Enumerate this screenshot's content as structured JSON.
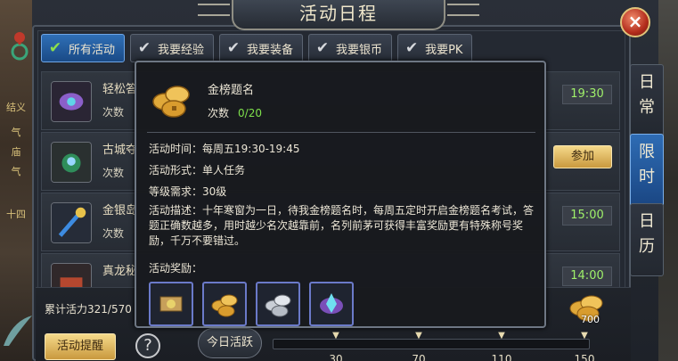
{
  "window": {
    "title": "活动日程",
    "close_label": "×"
  },
  "world_left": {
    "lines": [
      "结义",
      "气",
      "庙",
      "气",
      "十四"
    ]
  },
  "tabs": [
    {
      "label": "所有活动",
      "active": true
    },
    {
      "label": "我要经验",
      "active": false
    },
    {
      "label": "我要装备",
      "active": false
    },
    {
      "label": "我要银币",
      "active": false
    },
    {
      "label": "我要PK",
      "active": false
    }
  ],
  "activities": [
    {
      "name": "轻松答",
      "count_label": "次数",
      "time": "19:30",
      "icon": "purple-scroll-icon"
    },
    {
      "name": "古城夺",
      "count_label": "次数",
      "action_label": "参加",
      "icon": "green-dragon-icon"
    },
    {
      "name": "金银岛",
      "count_label": "次数",
      "time": "15:00",
      "icon": "blue-staff-icon"
    },
    {
      "name": "真龙秘",
      "count_label": "",
      "time": "14:00",
      "icon": "treasure-icon"
    }
  ],
  "side_tabs": [
    {
      "label": "日常",
      "active": false
    },
    {
      "label": "限时",
      "active": true
    },
    {
      "label": "日历",
      "active": false
    }
  ],
  "footer": {
    "vitality_text": "累计活力321/570",
    "remind_label": "活动提醒",
    "help_label": "?",
    "daily_label": "今日活跃",
    "milestones": [
      "30",
      "70",
      "110",
      "150"
    ],
    "chest_value": "700"
  },
  "tooltip": {
    "name": "金榜题名",
    "count_label": "次数",
    "count_value": "0/20",
    "time_text": "活动时间：每周五19:30-19:45",
    "form_text": "活动形式：单人任务",
    "level_text": "等级需求：30级",
    "desc_text": "活动描述：十年寒窗为一日，待我金榜题名时，每周五定时开启金榜题名考试，答题正确数越多，用时越少名次越靠前，名列前茅可获得丰富奖励更有特殊称号奖励，千万不要错过。",
    "reward_label": "活动奖励：",
    "rewards": [
      "scroll-reward-icon",
      "gold-coins-reward-icon",
      "silver-coins-reward-icon",
      "crystal-reward-icon"
    ]
  },
  "colors": {
    "accent_blue": "#2f6fb6",
    "gold": "#f5d98a",
    "progress_green": "#7ee04c",
    "time_green": "#9ff06a"
  }
}
